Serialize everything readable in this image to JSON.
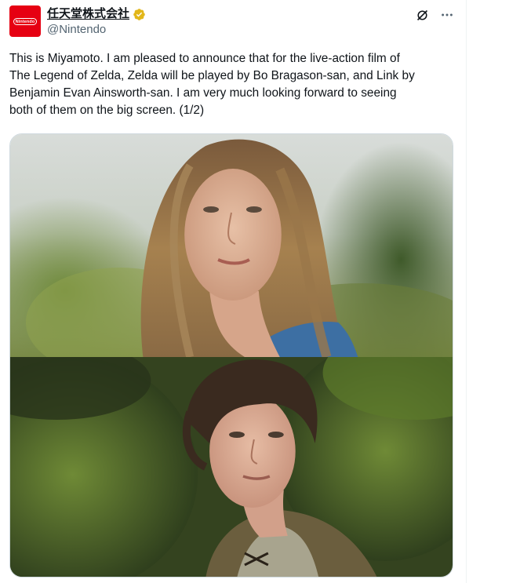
{
  "account": {
    "display_name": "任天堂株式会社",
    "handle": "@Nintendo",
    "avatar_text": "Nintendo",
    "brand_color": "#e60012",
    "verified_color": "#e2b719"
  },
  "icons": {
    "verified": "verified-badge-icon",
    "grok": "grok-icon",
    "more": "more-icon"
  },
  "more_label": "···",
  "tweet": {
    "text": "This is Miyamoto. I am pleased to announce that for the live-action film of\nThe Legend of Zelda, Zelda will be played by Bo Bragason-san, and Link by\nBenjamin Evan Ainsworth-san. I am very much looking forward to seeing\nboth of them on the big screen. (1/2)"
  },
  "media": {
    "photos": [
      "zelda-actress-photo",
      "link-actor-photo"
    ]
  }
}
